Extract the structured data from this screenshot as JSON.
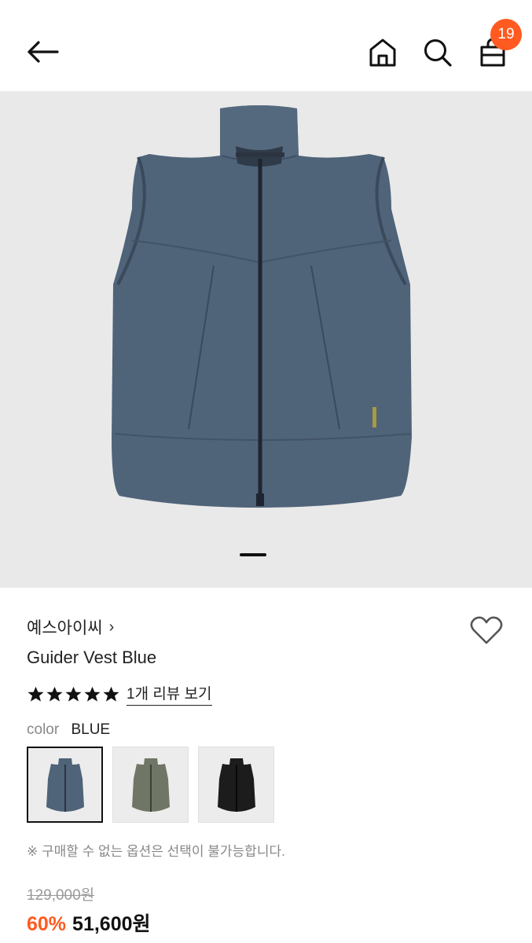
{
  "header": {
    "back_icon": "arrow-left-icon",
    "home_icon": "home-icon",
    "search_icon": "search-icon",
    "cart_icon": "shopping-bag-icon",
    "cart_count": "19"
  },
  "gallery": {
    "current_index": 1,
    "image": "navy-blue-vest"
  },
  "product": {
    "brand": "예스아이씨",
    "brand_chevron": "›",
    "name": "Guider Vest Blue",
    "rating": 5,
    "review_link": "1개 리뷰 보기",
    "color_label": "color",
    "color_value": "BLUE",
    "swatches": [
      {
        "color": "#4f6379",
        "name": "blue",
        "selected": true
      },
      {
        "color": "#6f7665",
        "name": "olive",
        "selected": false
      },
      {
        "color": "#1c1c1c",
        "name": "black",
        "selected": false
      }
    ],
    "notice": "※ 구매할 수 없는 옵션은 선택이 불가능합니다.",
    "original_price": "129,000원",
    "discount": "60%",
    "sale_price": "51,600원"
  },
  "colors": {
    "accent": "#ff5a1f",
    "vest": "#4f6379"
  }
}
